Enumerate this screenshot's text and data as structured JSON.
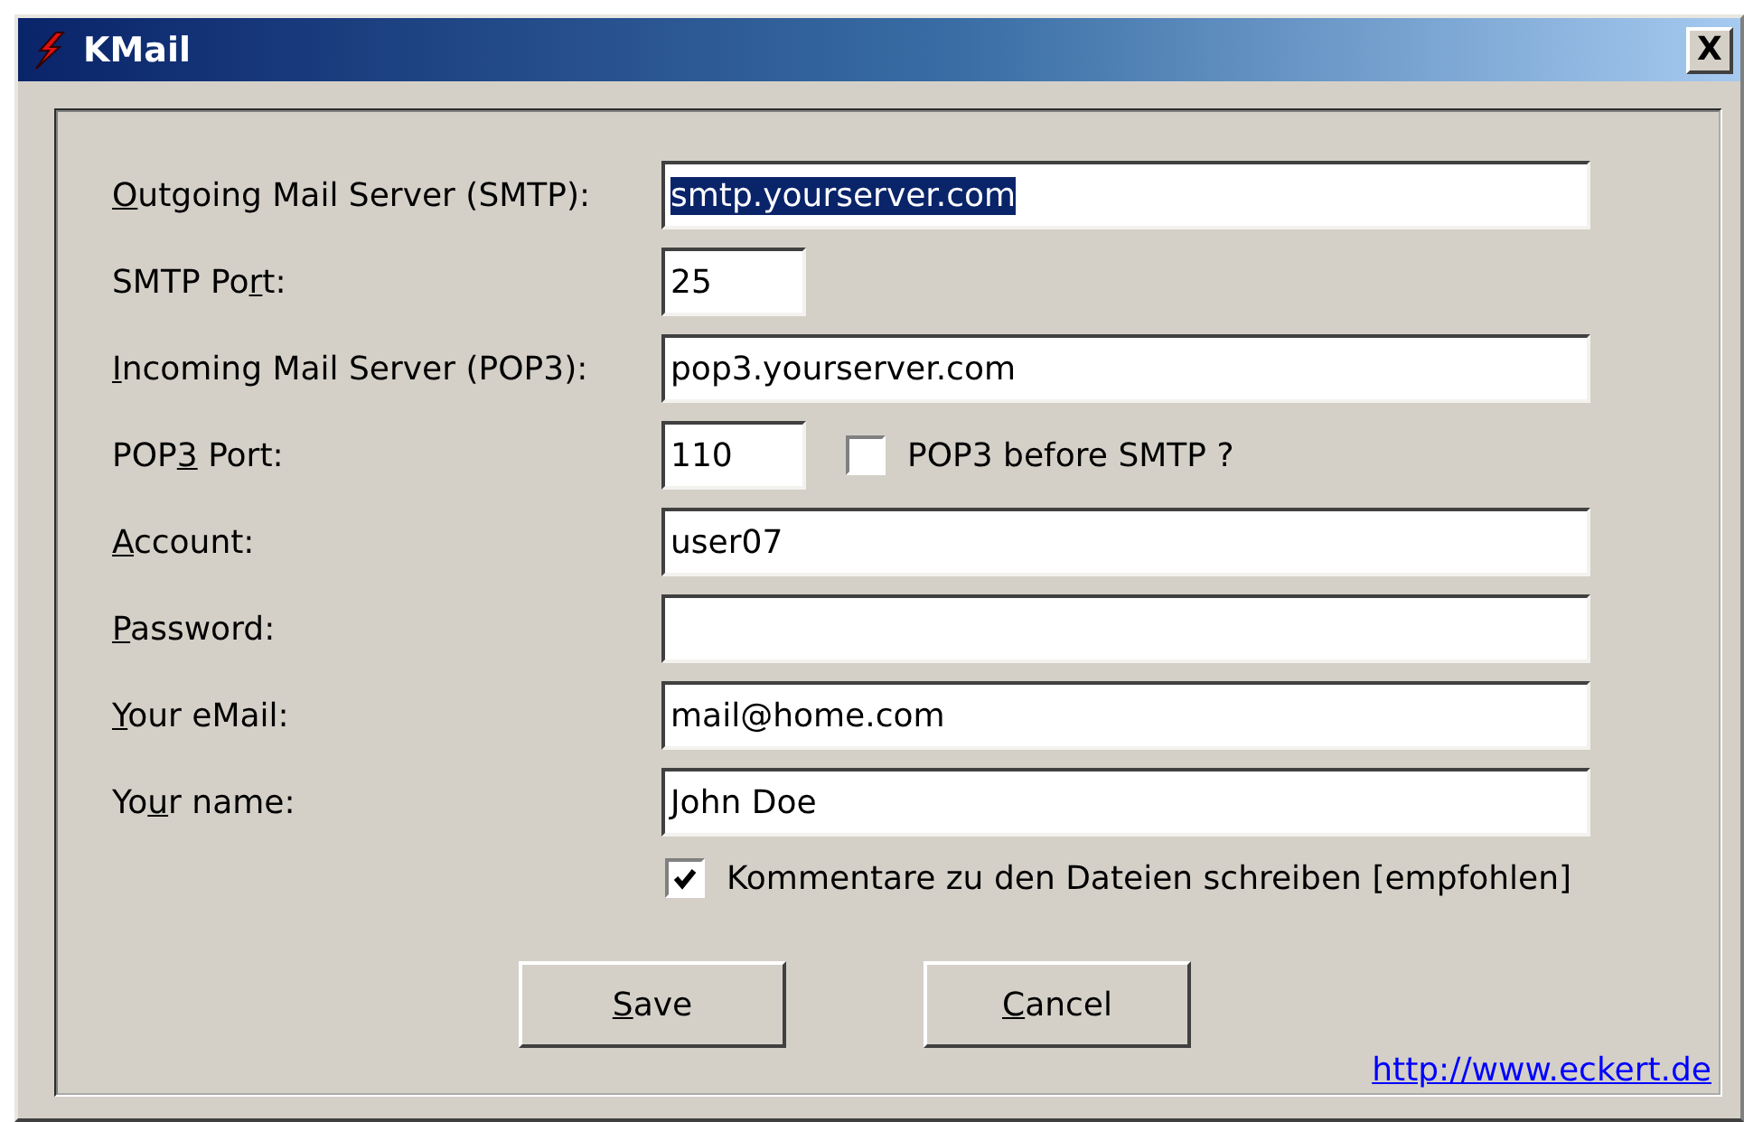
{
  "window": {
    "title": "KMail",
    "close": "X"
  },
  "fields": [
    {
      "kind": "wide",
      "label": {
        "key": "O",
        "after": "utgoing Mail Server (SMTP):"
      },
      "value": "smtp.yourserver.com",
      "selected": true
    },
    {
      "kind": "short",
      "label": {
        "before": "SMTP Po",
        "key": "r",
        "after": "t:"
      },
      "value": "25",
      "selected": false
    },
    {
      "kind": "wide",
      "label": {
        "key": "I",
        "after": "ncoming Mail Server (POP3):"
      },
      "value": "pop3.yourserver.com",
      "selected": false
    },
    {
      "kind": "short",
      "label": {
        "before": "POP",
        "key": "3",
        "after": " Port:"
      },
      "value": "110",
      "selected": false,
      "checkbox": {
        "label": "POP3 before SMTP ?",
        "checked": false
      }
    },
    {
      "kind": "wide",
      "label": {
        "key": "A",
        "after": "ccount:"
      },
      "value": "user07",
      "selected": false
    },
    {
      "kind": "wide",
      "label": {
        "key": "P",
        "after": "assword:"
      }
    },
    {
      "kind": "wide",
      "label": {
        "key": "Y",
        "after": "our eMail:"
      },
      "value": "mail@home.com",
      "selected": false
    },
    {
      "kind": "wide",
      "label": {
        "before": "Yo",
        "key": "u",
        "after": "r name:"
      },
      "value": "John Doe",
      "selected": false
    }
  ],
  "option": {
    "label": "Kommentare zu den Dateien schreiben [empfohlen]",
    "checked": true
  },
  "buttons": [
    {
      "key": "S",
      "after": "ave"
    },
    {
      "key": "C",
      "after": "ancel"
    }
  ],
  "link": "http://www.eckert.de"
}
